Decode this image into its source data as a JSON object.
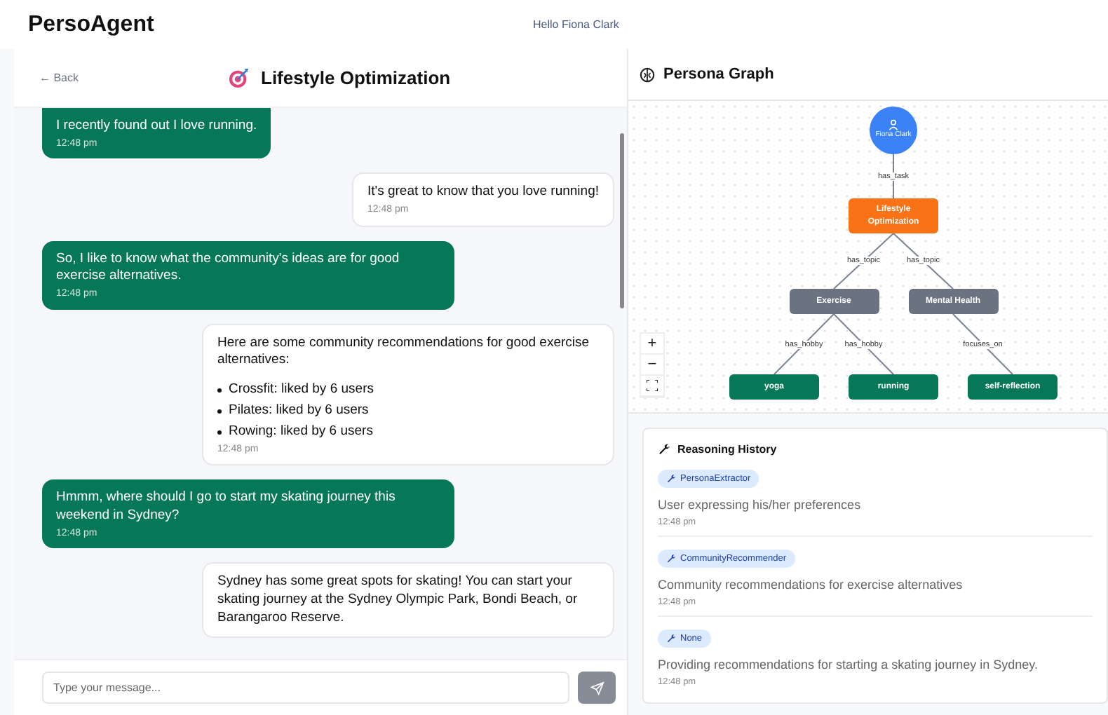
{
  "app": {
    "title": "PersoAgent",
    "greeting": "Hello Fiona Clark"
  },
  "chat": {
    "back": "← Back",
    "title": "Lifestyle Optimization",
    "messages": [
      {
        "kind": "user",
        "text": "I recently found out I love running.",
        "time": "12:48 pm"
      },
      {
        "kind": "agent",
        "text": "It's great to know that you love running!",
        "time": "12:48 pm"
      },
      {
        "kind": "user",
        "text": "So, I like to know what the community's ideas are for good exercise alternatives.",
        "time": "12:48 pm"
      },
      {
        "kind": "agent",
        "text": "Here are some community recommendations for good exercise alternatives:",
        "items": [
          "Crossfit: liked by 6 users",
          "Pilates: liked by 6 users",
          "Rowing: liked by 6 users"
        ],
        "time": "12:48 pm"
      },
      {
        "kind": "user",
        "text": "Hmmm, where should I go to start my skating journey this weekend in Sydney?",
        "time": "12:48 pm"
      },
      {
        "kind": "agent",
        "text": "Sydney has some great spots for skating! You can start your skating journey at the Sydney Olympic Park, Bondi Beach, or Barangaroo Reserve."
      }
    ],
    "input": {
      "placeholder": "Type your message..."
    }
  },
  "graph": {
    "title": "Persona Graph",
    "root": {
      "kind": "person",
      "label": "Fiona Clark",
      "children": [
        {
          "edge": "has_task",
          "kind": "task",
          "label": "Lifestyle Optimization",
          "children": [
            {
              "edge": "has_topic",
              "kind": "topic",
              "label": "Exercise",
              "children": [
                {
                  "edge": "has_hobby",
                  "kind": "leaf",
                  "label": "yoga"
                },
                {
                  "edge": "has_hobby",
                  "kind": "leaf",
                  "label": "running"
                }
              ]
            },
            {
              "edge": "has_topic",
              "kind": "topic",
              "label": "Mental Health",
              "children": [
                {
                  "edge": "focuses_on",
                  "kind": "leaf",
                  "label": "self-reflection"
                }
              ]
            }
          ]
        }
      ]
    },
    "controls": [
      "+",
      "−"
    ]
  },
  "reasoning": {
    "title": "Reasoning History",
    "entries": [
      {
        "agent": "PersonaExtractor",
        "text": "User expressing his/her preferences",
        "time": "12:48 pm"
      },
      {
        "agent": "CommunityRecommender",
        "text": "Community recommendations for exercise alternatives",
        "time": "12:48 pm"
      },
      {
        "agent": "None",
        "text": "Providing recommendations for starting a skating journey in Sydney.",
        "time": "12:48 pm"
      }
    ]
  }
}
